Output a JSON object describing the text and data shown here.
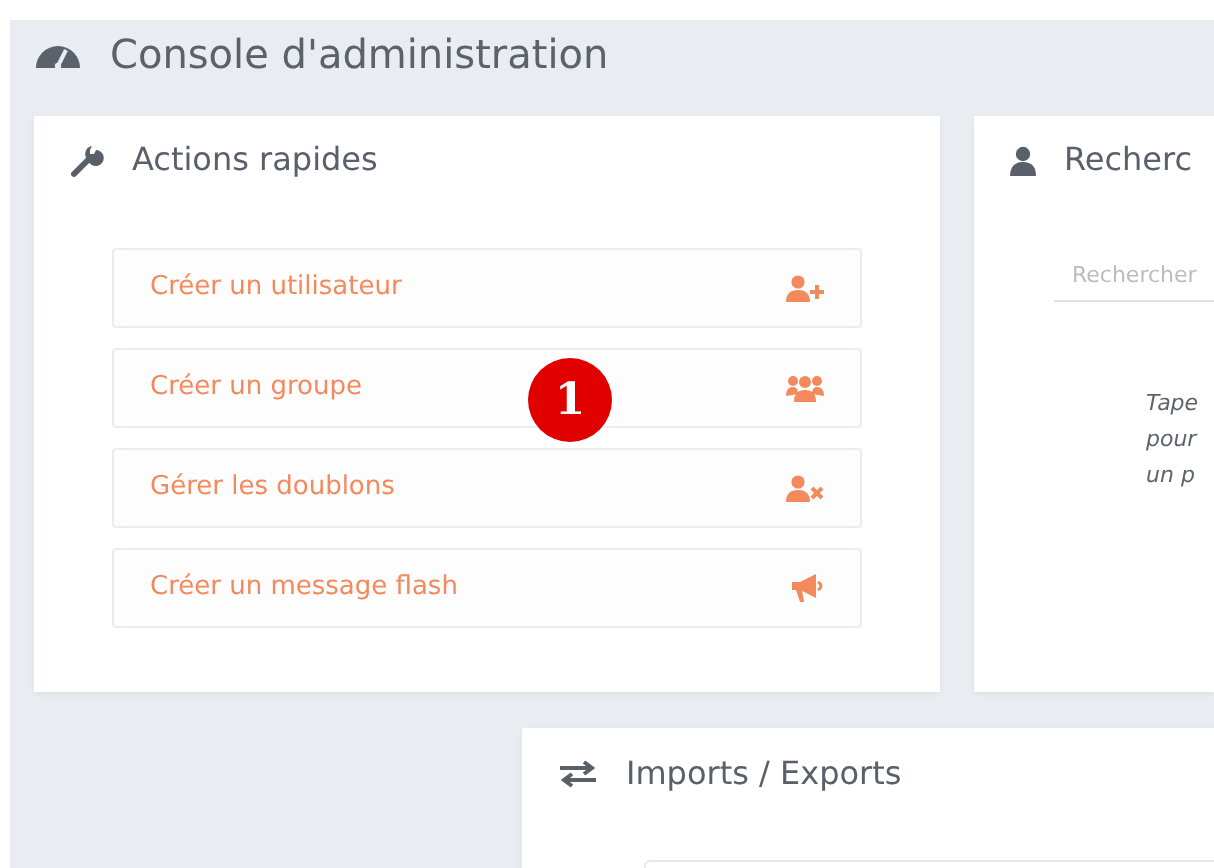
{
  "page_title": "Console d'administration",
  "quick_actions": {
    "title": "Actions rapides",
    "actions": [
      {
        "label": "Créer un utilisateur",
        "kind": "user"
      },
      {
        "label": "Créer un groupe",
        "kind": "group"
      },
      {
        "label": "Gérer les doublons",
        "kind": "duplicates"
      },
      {
        "label": "Créer un message flash",
        "kind": "flash"
      }
    ]
  },
  "search_panel": {
    "title": "Recherc",
    "search": {
      "placeholder": "Rechercher"
    },
    "hint_lines": [
      "Tape",
      "pour",
      "un p"
    ]
  },
  "imports_exports": {
    "title": "Imports / Exports"
  },
  "callout": "1"
}
